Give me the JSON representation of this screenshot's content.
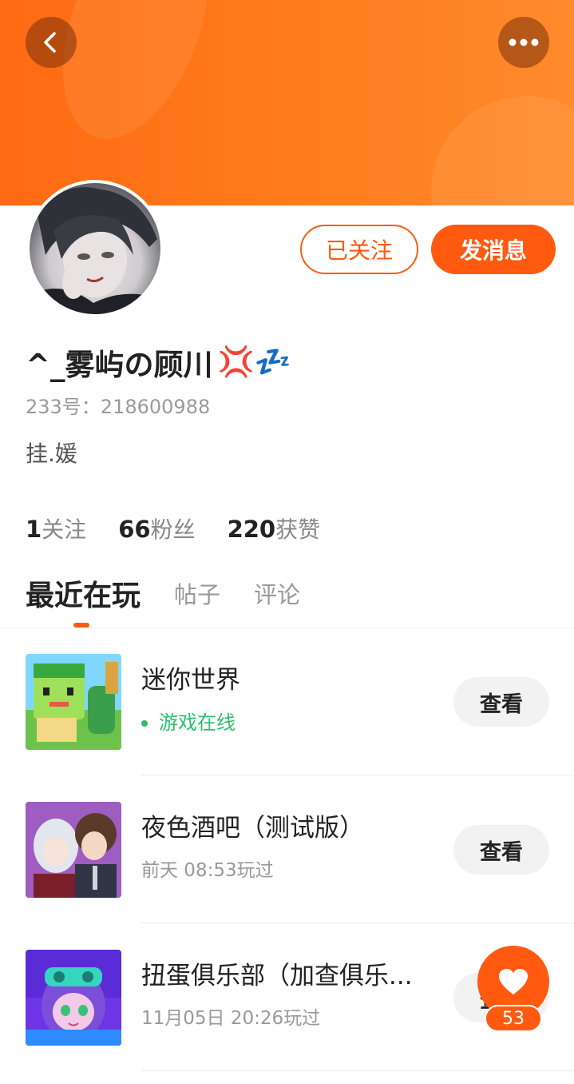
{
  "header": {
    "back_icon": "chevron-left-icon",
    "more_icon": "more-horizontal-icon",
    "banner_color": "#ff6a13"
  },
  "profile": {
    "avatar_icon": "user-avatar",
    "followed_label": "已关注",
    "message_label": "发消息",
    "username": "^_雾屿の顾川",
    "username_emoji": "💢💤",
    "id_text": "233号：218600988",
    "bio": "挂.媛"
  },
  "stats": [
    {
      "num": "1",
      "label": "关注"
    },
    {
      "num": "66",
      "label": "粉丝"
    },
    {
      "num": "220",
      "label": "获赞"
    }
  ],
  "tabs": [
    {
      "label": "最近在玩",
      "active": true
    },
    {
      "label": "帖子",
      "active": false
    },
    {
      "label": "评论",
      "active": false
    }
  ],
  "games": [
    {
      "name": "迷你世界",
      "status": "游戏在线",
      "online": true,
      "button": "查看"
    },
    {
      "name": "夜色酒吧（测试版）",
      "status": "前天 08:53玩过",
      "online": false,
      "button": "查看"
    },
    {
      "name": "扭蛋俱乐部（加查俱乐...",
      "status": "11月05日 20:26玩过",
      "online": false,
      "button": "查看"
    }
  ],
  "like": {
    "icon": "heart-icon",
    "count": "53"
  },
  "colors": {
    "accent": "#ff5a10",
    "online": "#2cbf6b"
  }
}
